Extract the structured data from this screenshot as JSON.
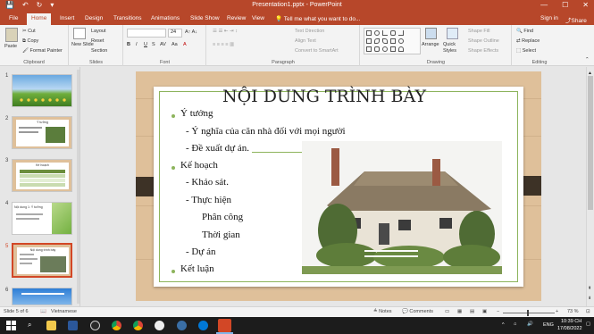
{
  "titlebar": {
    "title": "Presentation1.pptx - PowerPoint",
    "save_icon": "💾",
    "undo_icon": "↶",
    "redo_icon": "↻",
    "qat_more_icon": "▾",
    "minimize": "—",
    "maximize": "☐",
    "close": "✕"
  },
  "tabs": [
    "File",
    "Home",
    "Insert",
    "Design",
    "Transitions",
    "Animations",
    "Slide Show",
    "Review",
    "View"
  ],
  "tell_me": "Tell me what you want to do...",
  "sign_in": "Sign in",
  "share": "Share",
  "ribbon": {
    "clipboard": {
      "paste": "Paste",
      "cut": "Cut",
      "copy": "Copy",
      "format_painter": "Format Painter",
      "label": "Clipboard"
    },
    "slides": {
      "new_slide": "New Slide",
      "layout": "Layout",
      "reset": "Reset",
      "section": "Section",
      "label": "Slides"
    },
    "font": {
      "size": "24",
      "label": "Font",
      "bold": "B",
      "italic": "I",
      "underline": "U",
      "strike": "S",
      "spacing": "AV",
      "case": "Aa",
      "color": "A"
    },
    "paragraph": {
      "text_direction": "Text Direction",
      "align_text": "Align Text",
      "convert_smartart": "Convert to SmartArt",
      "label": "Paragraph"
    },
    "drawing": {
      "arrange": "Arrange",
      "quick_styles": "Quick Styles",
      "shape_fill": "Shape Fill",
      "shape_outline": "Shape Outline",
      "shape_effects": "Shape Effects",
      "label": "Drawing"
    },
    "editing": {
      "find": "Find",
      "replace": "Replace",
      "select": "Select",
      "label": "Editing"
    }
  },
  "thumbnails": [
    {
      "num": "1"
    },
    {
      "num": "2",
      "title": "Ý tưởng"
    },
    {
      "num": "3",
      "title": "Kế hoạch"
    },
    {
      "num": "4",
      "title": "Nội dung 1: Ý tưởng"
    },
    {
      "num": "5",
      "title": "Nội dung trình bày"
    },
    {
      "num": "6"
    }
  ],
  "slide": {
    "title": "NỘI DUNG TRÌNH BÀY",
    "lines": [
      "Ý tưởng",
      "- Ý nghĩa của căn nhà đối với mọi người",
      "- Đề xuất dự án.",
      "Kế hoạch",
      "- Khảo sát.",
      "- Thực hiện",
      "Phân công",
      "Thời gian",
      "- Dự án",
      "Kết luận"
    ]
  },
  "status": {
    "slide_info": "Slide 5 of 6",
    "language": "Vietnamese",
    "notes": "Notes",
    "comments": "Comments",
    "zoom": "73 %"
  },
  "taskbar": {
    "time": "10:39 CH",
    "date": "17/08/2022",
    "lang": "ENG",
    "up_arrow": "^"
  },
  "colors": {
    "brand": "#b7472a",
    "accent_green": "#8db45c",
    "wood": "#dfc09a",
    "dark_tab": "#3d3226"
  }
}
